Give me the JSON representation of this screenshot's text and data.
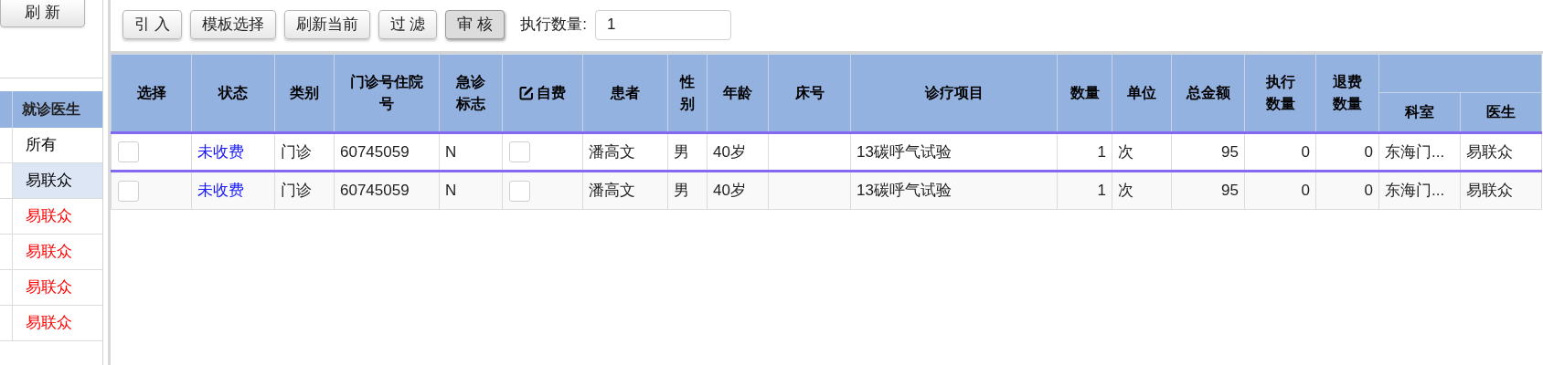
{
  "sidebar": {
    "refresh_button": "刷 新",
    "list_header": "就诊医生",
    "items": [
      {
        "label": "所有",
        "selected": false,
        "color": "#000000"
      },
      {
        "label": "易联众",
        "selected": true,
        "color": "#000000"
      },
      {
        "label": "易联众",
        "selected": false,
        "color": "#ff0000"
      },
      {
        "label": "易联众",
        "selected": false,
        "color": "#ff0000"
      },
      {
        "label": "易联众",
        "selected": false,
        "color": "#ff0000"
      },
      {
        "label": "易联众",
        "selected": false,
        "color": "#ff0000"
      }
    ]
  },
  "toolbar": {
    "buttons": [
      {
        "label": "引 入",
        "pressed": false
      },
      {
        "label": "模板选择",
        "pressed": false
      },
      {
        "label": "刷新当前",
        "pressed": false
      },
      {
        "label": "过 滤",
        "pressed": false
      },
      {
        "label": "审 核",
        "pressed": true
      }
    ],
    "count_label": "执行数量:",
    "count_value": "1"
  },
  "table": {
    "columns": [
      {
        "label": "选择",
        "kind": "checkbox",
        "editable": false,
        "grouped": false
      },
      {
        "label": "状态",
        "kind": "link",
        "editable": false,
        "grouped": false
      },
      {
        "label": "类别",
        "kind": "text",
        "editable": false,
        "grouped": false
      },
      {
        "label": "门诊号住院号",
        "kind": "text",
        "editable": false,
        "grouped": false
      },
      {
        "label": "急诊标志",
        "kind": "text",
        "editable": false,
        "grouped": false
      },
      {
        "label": "自费",
        "kind": "checkbox",
        "editable": true,
        "grouped": false
      },
      {
        "label": "患者",
        "kind": "text",
        "editable": false,
        "grouped": false
      },
      {
        "label": "性别",
        "kind": "text",
        "editable": false,
        "grouped": false
      },
      {
        "label": "年龄",
        "kind": "text",
        "editable": false,
        "grouped": false
      },
      {
        "label": "床号",
        "kind": "text",
        "editable": false,
        "grouped": false
      },
      {
        "label": "诊疗项目",
        "kind": "text",
        "editable": false,
        "grouped": false
      },
      {
        "label": "数量",
        "kind": "number",
        "editable": false,
        "grouped": false
      },
      {
        "label": "单位",
        "kind": "text",
        "editable": false,
        "grouped": false
      },
      {
        "label": "总金额",
        "kind": "number",
        "editable": false,
        "grouped": false
      },
      {
        "label": "执行数量",
        "kind": "number",
        "editable": false,
        "grouped": false
      },
      {
        "label": "退费数量",
        "kind": "number",
        "editable": false,
        "grouped": false
      },
      {
        "label": "科室",
        "kind": "text",
        "editable": false,
        "grouped": true
      },
      {
        "label": "医生",
        "kind": "text",
        "editable": false,
        "grouped": true
      }
    ],
    "rows": [
      {
        "selected": true,
        "cells": [
          {
            "checked": false
          },
          "未收费",
          "门诊",
          "60745059",
          "N",
          {
            "checked": false
          },
          "潘高文",
          "男",
          "40岁",
          null,
          "13碳呼气试验",
          "1",
          "次",
          "95",
          "0",
          "0",
          "东海门...",
          "易联众"
        ]
      },
      {
        "selected": false,
        "cells": [
          {
            "checked": false
          },
          "未收费",
          "门诊",
          "60745059",
          "N",
          {
            "checked": false
          },
          "潘高文",
          "男",
          "40岁",
          null,
          "13碳呼气试验",
          "1",
          "次",
          "95",
          "0",
          "0",
          "东海门...",
          "易联众"
        ]
      }
    ]
  }
}
